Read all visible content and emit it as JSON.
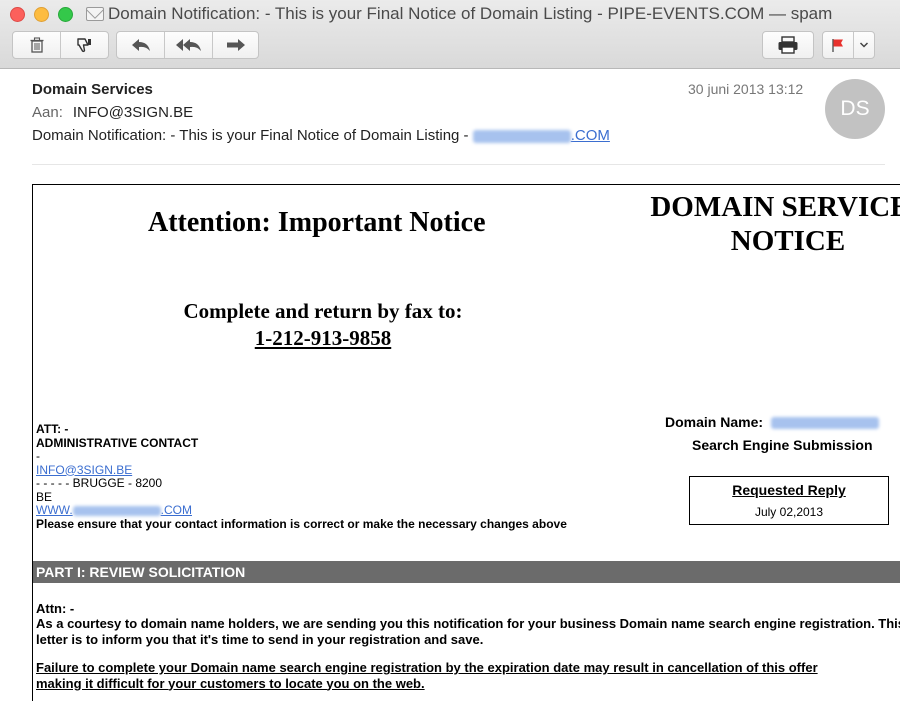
{
  "window": {
    "title": "Domain Notification: - This is your Final Notice of Domain Listing - PIPE-EVENTS.COM — spam"
  },
  "toolbar": {
    "icons": [
      "trash-icon",
      "junk-thumbs-down-icon",
      "reply-icon",
      "reply-all-icon",
      "forward-icon",
      "print-icon",
      "flag-icon",
      "chevron-down-icon"
    ],
    "flag_color": "#e8312d"
  },
  "header": {
    "sender": "Domain Services",
    "to_label": "Aan:",
    "to_value": "INFO@3SIGN.BE",
    "subject_prefix": "Domain Notification: - This is your Final Notice of Domain Listing - ",
    "subject_suffix": ".COM",
    "date": "30 juni 2013 13:12",
    "avatar_initials": "DS"
  },
  "letter": {
    "attention": "Attention: Important Notice",
    "notice_line1": "DOMAIN SERVICES",
    "notice_line2": "NOTICE",
    "fax_label": "Complete and return by fax to:",
    "fax_number": "1-212-913-9858",
    "domain_name_label": "Domain Name:",
    "search_engine": "Search Engine Submission",
    "requested_reply": "Requested Reply",
    "reply_date": "July 02,2013",
    "contact": {
      "att": "ATT: -",
      "admin": "ADMINISTRATIVE CONTACT",
      "dash": "-",
      "email": "INFO@3SIGN.BE",
      "address": "- - - - - BRUGGE - 8200",
      "country": "BE",
      "www_prefix": "WWW.",
      "www_suffix": ".COM",
      "ensure": "Please ensure that your contact information is correct or make the necessary changes above"
    },
    "part1_title": "PART I: REVIEW SOLICITATION",
    "attn": "Attn: -",
    "para1": "As a courtesy to domain name holders, we are sending you this notification for your business Domain name search engine registration. This letter is to inform you that it's time to send in your registration and save.",
    "para2_line1": "Failure to complete your Domain name search engine registration by the expiration date may result in cancellation of this offer",
    "para2_line2": "making it difficult for your customers to locate you on the web."
  }
}
